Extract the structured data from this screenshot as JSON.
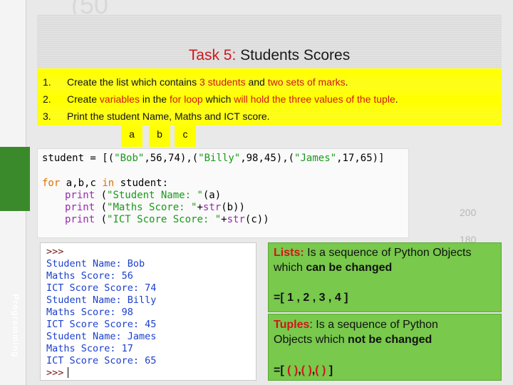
{
  "slide": {
    "title_task": "Task 5:",
    "title_rest": "Students Scores",
    "side_label": "Programming",
    "background_numbers": [
      "(50",
      "200",
      "180"
    ]
  },
  "tasks": [
    {
      "num": "1.",
      "parts": [
        "Create the list which contains ",
        "3 students",
        " and ",
        "two sets of marks",
        "."
      ]
    },
    {
      "num": "2.",
      "parts": [
        "Create ",
        "variables",
        " in the ",
        "for loop",
        " which ",
        "will hold the three values of the tuple",
        "."
      ]
    },
    {
      "num": "3.",
      "text": "Print the student Name, Maths and ICT score."
    }
  ],
  "loop_vars": [
    "a",
    "b",
    "c"
  ],
  "code": {
    "line1": {
      "prefix": "student = [(",
      "s1": "\"Bob\"",
      "m1": ",56,74),(",
      "s2": "\"Billy\"",
      "m2": ",98,45),(",
      "s3": "\"James\"",
      "m3": ",17,65)]"
    },
    "line2": {
      "kw1": "for",
      "mid": " a,b,c ",
      "kw2": "in",
      "rest": " student:"
    },
    "line3": {
      "fn": "print",
      "open": " (",
      "str": "\"Student Name: \"",
      "rest": "(a)"
    },
    "line4": {
      "fn": "print",
      "open": " (",
      "str": "\"Maths Score: \"",
      "plus": "+",
      "fn2": "str",
      "rest": "(b))"
    },
    "line5": {
      "fn": "print",
      "open": " (",
      "str": "\"ICT Score Score: \"",
      "plus": "+",
      "fn2": "str",
      "rest": "(c))"
    }
  },
  "shell": {
    "prompt": ">>>",
    "output": [
      "Student Name: Bob",
      "Maths Score: 56",
      "ICT Score Score: 74",
      "Student Name: Billy",
      "Maths Score: 98",
      "ICT Score Score: 45",
      "Student Name: James",
      "Maths Score: 17",
      "ICT Score Score: 65"
    ],
    "end_prompt": ">>>"
  },
  "lists_box": {
    "term": "Lists:",
    "line1_rest": " Is a sequence of Python Objects",
    "line2_plain": "which ",
    "line2_bold": "can be changed",
    "example": "=[ 1 , 2 , 3 , 4  ]"
  },
  "tuples_box": {
    "term": "Tuples",
    "line1_rest": ": Is a sequence of Python",
    "line2_plain": "Objects which ",
    "line2_bold": "not be changed",
    "example_open": "=[ ",
    "paren1": "(  )",
    "sep1": ",",
    "paren2": "(  )",
    "sep2": ",",
    "paren3": "(  )",
    "example_close": " ]"
  },
  "colors": {
    "accent_red": "#d0161b",
    "task_yellow": "#ffff00",
    "info_green": "#78c94c",
    "side_green": "#3a8a2c",
    "string_green": "#1a9a1a",
    "keyword_orange": "#e07000",
    "builtin_purple": "#9a2ab0",
    "shell_blue": "#1a3fcf"
  }
}
